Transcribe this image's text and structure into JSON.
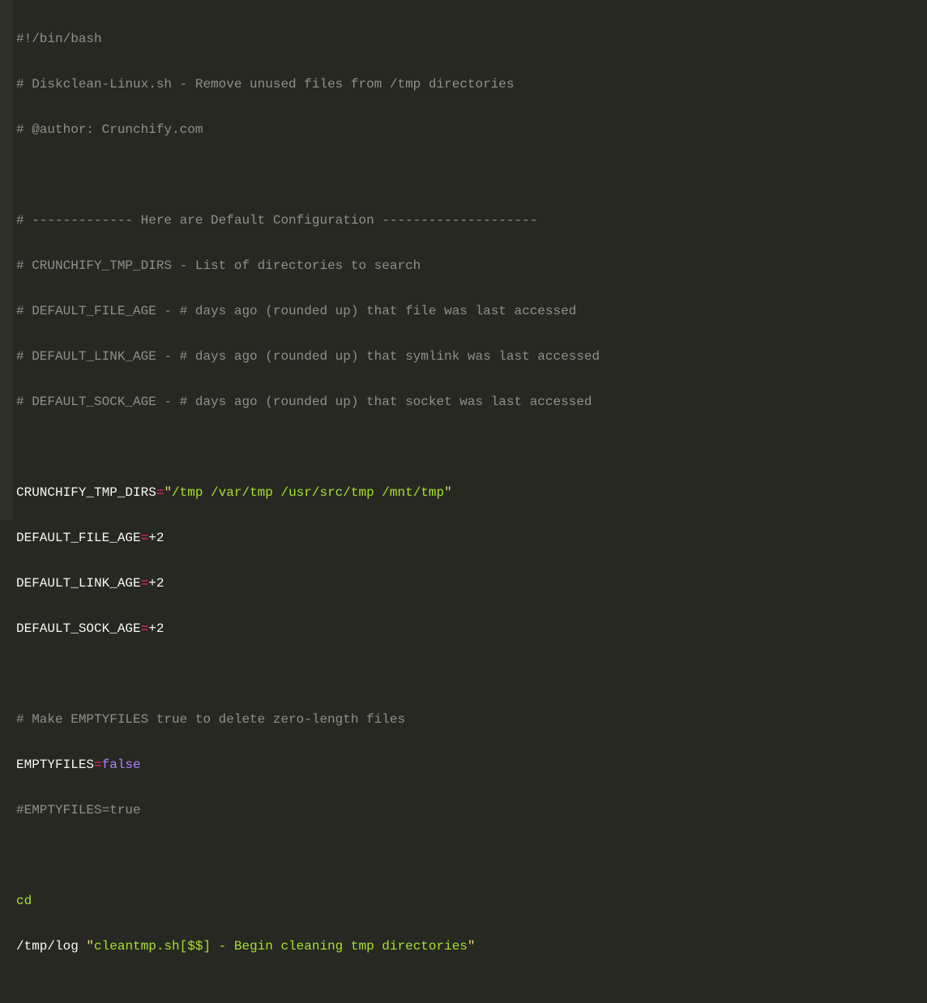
{
  "code": {
    "shebang": "#!/bin/bash",
    "c1": "# Diskclean-Linux.sh - Remove unused files from /tmp directories",
    "c2": "# @author: Crunchify.com",
    "c3": "# ------------- Here are Default Configuration --------------------",
    "c4": "# CRUNCHIFY_TMP_DIRS - List of directories to search",
    "c5": "# DEFAULT_FILE_AGE - # days ago (rounded up) that file was last accessed",
    "c6": "# DEFAULT_LINK_AGE - # days ago (rounded up) that symlink was last accessed",
    "c7": "# DEFAULT_SOCK_AGE - # days ago (rounded up) that socket was last accessed",
    "v1name": "CRUNCHIFY_TMP_DIRS",
    "v1eq": "=",
    "v1q1": "\"",
    "v1val": "/tmp /var/tmp /usr/src/tmp /mnt/tmp",
    "v1q2": "\"",
    "v2name": "DEFAULT_FILE_AGE",
    "v2eq": "=",
    "v2val": "+2",
    "v3name": "DEFAULT_LINK_AGE",
    "v3eq": "=",
    "v3val": "+2",
    "v4name": "DEFAULT_SOCK_AGE",
    "v4eq": "=",
    "v4val": "+2",
    "c8": "# Make EMPTYFILES true to delete zero-length files",
    "v5name": "EMPTYFILES",
    "v5eq": "=",
    "v5val": "false",
    "c9": "#EMPTYFILES=true",
    "cmd1": "cd",
    "path1": "/tmp/log ",
    "str1q1": "\"",
    "str1a": "cleantmp.sh[",
    "str1var": "$$",
    "str1b": "] - Begin cleaning tmp directories",
    "str1q2": "\""
  }
}
